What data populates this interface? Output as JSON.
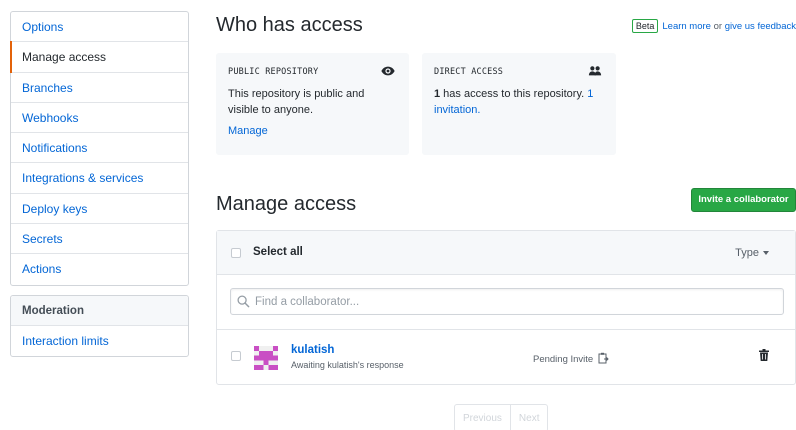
{
  "sidebar": {
    "items": [
      {
        "label": "Options"
      },
      {
        "label": "Manage access"
      },
      {
        "label": "Branches"
      },
      {
        "label": "Webhooks"
      },
      {
        "label": "Notifications"
      },
      {
        "label": "Integrations & services"
      },
      {
        "label": "Deploy keys"
      },
      {
        "label": "Secrets"
      },
      {
        "label": "Actions"
      }
    ],
    "selected": "Manage access",
    "moderation": {
      "heading": "Moderation",
      "items": [
        {
          "label": "Interaction limits"
        }
      ]
    }
  },
  "header": {
    "title": "Who has access",
    "beta_badge": "Beta",
    "learn_more": "Learn more",
    "or_text": " or ",
    "feedback": "give us feedback"
  },
  "public_box": {
    "label": "PUBLIC REPOSITORY",
    "icon": "eye-icon",
    "text": "This repository is public and visible to anyone.",
    "link": "Manage"
  },
  "direct_box": {
    "label": "DIRECT ACCESS",
    "icon": "people-icon",
    "count": "1",
    "text": " has access to this repository. ",
    "invitation_link": "1 invitation."
  },
  "manage": {
    "title": "Manage access",
    "invite_button": "Invite a collaborator",
    "select_all": "Select all",
    "type_filter": "Type",
    "search_placeholder": "Find a collaborator...",
    "search_value": ""
  },
  "members": [
    {
      "name": "kulatish",
      "subtitle": "Awaiting kulatish's response",
      "status": "Pending Invite",
      "avatar_color": "#c94fc4"
    }
  ],
  "pagination": {
    "previous": "Previous",
    "next": "Next"
  },
  "colors": {
    "link": "#0366d6",
    "accent": "#e36209",
    "primary_button": "#28a745"
  }
}
